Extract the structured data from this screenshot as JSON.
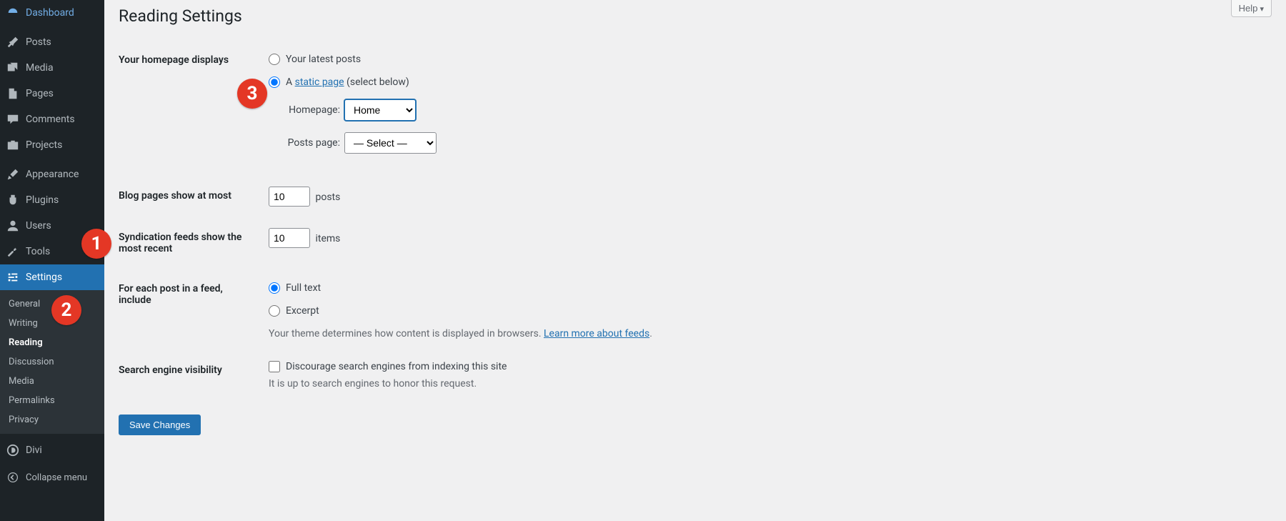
{
  "sidebar": {
    "items": [
      {
        "label": "Dashboard",
        "icon": "dashboard"
      },
      {
        "label": "Posts",
        "icon": "posts"
      },
      {
        "label": "Media",
        "icon": "media"
      },
      {
        "label": "Pages",
        "icon": "pages"
      },
      {
        "label": "Comments",
        "icon": "comments"
      },
      {
        "label": "Projects",
        "icon": "projects"
      },
      {
        "label": "Appearance",
        "icon": "appearance"
      },
      {
        "label": "Plugins",
        "icon": "plugins"
      },
      {
        "label": "Users",
        "icon": "users"
      },
      {
        "label": "Tools",
        "icon": "tools"
      },
      {
        "label": "Settings",
        "icon": "settings"
      },
      {
        "label": "Divi",
        "icon": "divi"
      }
    ],
    "submenu": {
      "items": [
        {
          "label": "General"
        },
        {
          "label": "Writing"
        },
        {
          "label": "Reading"
        },
        {
          "label": "Discussion"
        },
        {
          "label": "Media"
        },
        {
          "label": "Permalinks"
        },
        {
          "label": "Privacy"
        }
      ]
    },
    "collapse": "Collapse menu"
  },
  "page": {
    "title": "Reading Settings",
    "help": "Help"
  },
  "form": {
    "homepage_displays": {
      "label": "Your homepage displays",
      "opt_latest": "Your latest posts",
      "opt_static_prefix": "A ",
      "opt_static_link": "static page",
      "opt_static_suffix": " (select below)",
      "homepage_label": "Homepage:",
      "homepage_value": "Home",
      "postspage_label": "Posts page:",
      "postspage_value": "— Select —"
    },
    "blog_pages": {
      "label": "Blog pages show at most",
      "value": "10",
      "suffix": "posts"
    },
    "syndication": {
      "label": "Syndication feeds show the most recent",
      "value": "10",
      "suffix": "items"
    },
    "feed_include": {
      "label": "For each post in a feed, include",
      "opt_full": "Full text",
      "opt_excerpt": "Excerpt",
      "desc_prefix": "Your theme determines how content is displayed in browsers. ",
      "desc_link": "Learn more about feeds",
      "desc_suffix": "."
    },
    "search_visibility": {
      "label": "Search engine visibility",
      "checkbox_label": "Discourage search engines from indexing this site",
      "desc": "It is up to search engines to honor this request."
    },
    "save": "Save Changes"
  },
  "annotations": {
    "b1": "1",
    "b2": "2",
    "b3": "3"
  }
}
